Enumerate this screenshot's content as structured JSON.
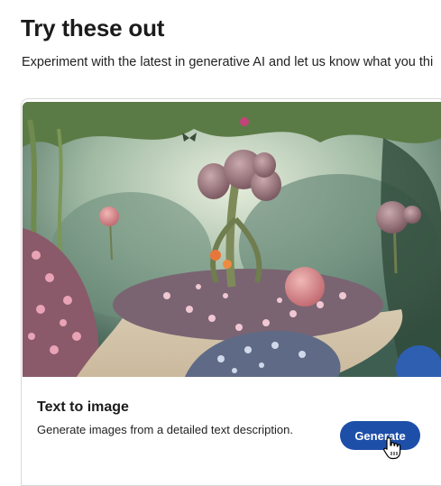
{
  "section": {
    "title": "Try these out",
    "subtitle": "Experiment with the latest in generative AI and let us know what you thi"
  },
  "card": {
    "image_alt": "fantasy-garden-artwork",
    "title": "Text to image",
    "description": "Generate images from a detailed text description.",
    "button_label": "Generate"
  },
  "colors": {
    "accent": "#1d4fa8",
    "border": "#d9d9d9"
  },
  "icons": {
    "cursor": "hand-pointer-icon"
  }
}
